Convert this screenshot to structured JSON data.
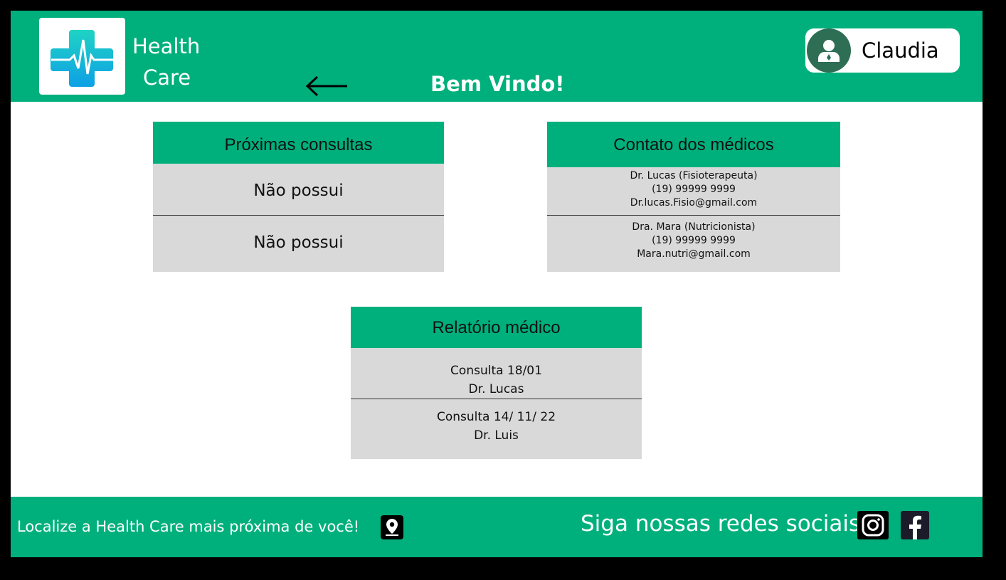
{
  "header": {
    "brand_line1": "Health",
    "brand_line2": "Care",
    "welcome": "Bem Vindo!",
    "user_name": "Claudia"
  },
  "appointments": {
    "title": "Próximas consultas",
    "items": [
      "Não possui",
      "Não possui"
    ]
  },
  "contacts": {
    "title": "Contato dos médicos",
    "items": [
      {
        "name": "Dr. Lucas (Fisioterapeuta)",
        "phone": "(19) 99999 9999",
        "email": "Dr.lucas.Fisio@gmail.com"
      },
      {
        "name": "Dra. Mara (Nutricionista)",
        "phone": "(19) 99999 9999",
        "email": "Mara.nutri@gmail.com"
      }
    ]
  },
  "reports": {
    "title": "Relatório médico",
    "items": [
      {
        "consult": "Consulta 18/01",
        "doctor": "Dr. Lucas"
      },
      {
        "consult": "Consulta 14/ 11/ 22",
        "doctor": "Dr. Luis"
      }
    ]
  },
  "footer": {
    "locate_text": "Localize a Health Care mais próxima de você!",
    "social_text": "Siga nossas redes sociais"
  },
  "colors": {
    "brand_green": "#00b07c",
    "card_gray": "#d9d9d9",
    "avatar_green": "#2e6e55"
  },
  "icons": [
    "medical-cross-logo-icon",
    "back-arrow-icon",
    "user-icon",
    "location-pin-icon",
    "instagram-icon",
    "facebook-icon"
  ]
}
